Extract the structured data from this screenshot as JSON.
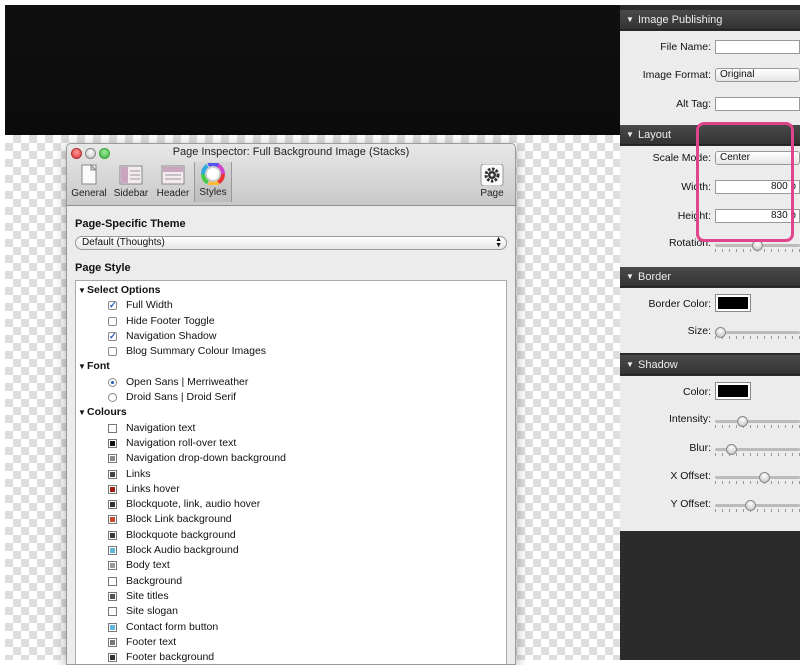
{
  "inspector": {
    "title": "Page Inspector: Full Background Image (Stacks)",
    "toolbar": {
      "general": "General",
      "sidebar": "Sidebar",
      "header": "Header",
      "styles": "Styles",
      "page": "Page"
    },
    "theme_section": "Page-Specific Theme",
    "theme_value": "Default (Thoughts)",
    "style_section": "Page Style",
    "groups": {
      "select_options": {
        "label": "Select Options",
        "items": [
          {
            "label": "Full Width",
            "checked": true
          },
          {
            "label": "Hide Footer Toggle",
            "checked": false
          },
          {
            "label": "Navigation Shadow",
            "checked": true
          },
          {
            "label": "Blog Summary Colour Images",
            "checked": false
          }
        ]
      },
      "font": {
        "label": "Font",
        "items": [
          {
            "label": "Open Sans  |  Merriweather",
            "selected": true
          },
          {
            "label": "Droid Sans  |  Droid Serif",
            "selected": false
          }
        ]
      },
      "colours": {
        "label": "Colours",
        "items": [
          {
            "label": "Navigation text",
            "color": "#ffffff"
          },
          {
            "label": "Navigation roll-over text",
            "color": "#111111"
          },
          {
            "label": "Navigation drop-down background",
            "color": "#8a8a8a"
          },
          {
            "label": "Links",
            "color": "#444444"
          },
          {
            "label": "Links hover",
            "color": "#a01c14"
          },
          {
            "label": "Blockquote, link, audio hover",
            "color": "#333333"
          },
          {
            "label": "Block Link background",
            "color": "#c84a28"
          },
          {
            "label": "Blockquote background",
            "color": "#3a3a3a"
          },
          {
            "label": "Block Audio background",
            "color": "#5fb8d8"
          },
          {
            "label": "Body text",
            "color": "#999999"
          },
          {
            "label": "Background",
            "color": "#ffffff"
          },
          {
            "label": "Site titles",
            "color": "#555555"
          },
          {
            "label": "Site slogan",
            "color": "#ffffff"
          },
          {
            "label": "Contact form button",
            "color": "#62b8e0"
          },
          {
            "label": "Footer text",
            "color": "#777777"
          },
          {
            "label": "Footer background",
            "color": "#333333"
          }
        ]
      }
    }
  },
  "right_panel": {
    "image_publishing": {
      "heading": "Image Publishing",
      "file_name_label": "File Name:",
      "file_name_value": "",
      "image_format_label": "Image Format:",
      "image_format_value": "Original",
      "alt_tag_label": "Alt Tag:",
      "alt_tag_value": ""
    },
    "layout": {
      "heading": "Layout",
      "scale_mode_label": "Scale Mode:",
      "scale_mode_value": "Center",
      "width_label": "Width:",
      "width_value": "800 p",
      "height_label": "Height:",
      "height_value": "830 p",
      "rotation_label": "Rotation:",
      "rotation_level": 0.5
    },
    "border": {
      "heading": "Border",
      "color_label": "Border Color:",
      "color": "#000000",
      "size_label": "Size:",
      "size_level": 0.0
    },
    "shadow": {
      "heading": "Shadow",
      "color_label": "Color:",
      "color": "#000000",
      "intensity_label": "Intensity:",
      "intensity_level": 0.3,
      "blur_label": "Blur:",
      "blur_level": 0.15,
      "x_offset_label": "X Offset:",
      "x_offset_level": 0.6,
      "y_offset_label": "Y Offset:",
      "y_offset_level": 0.4
    }
  }
}
